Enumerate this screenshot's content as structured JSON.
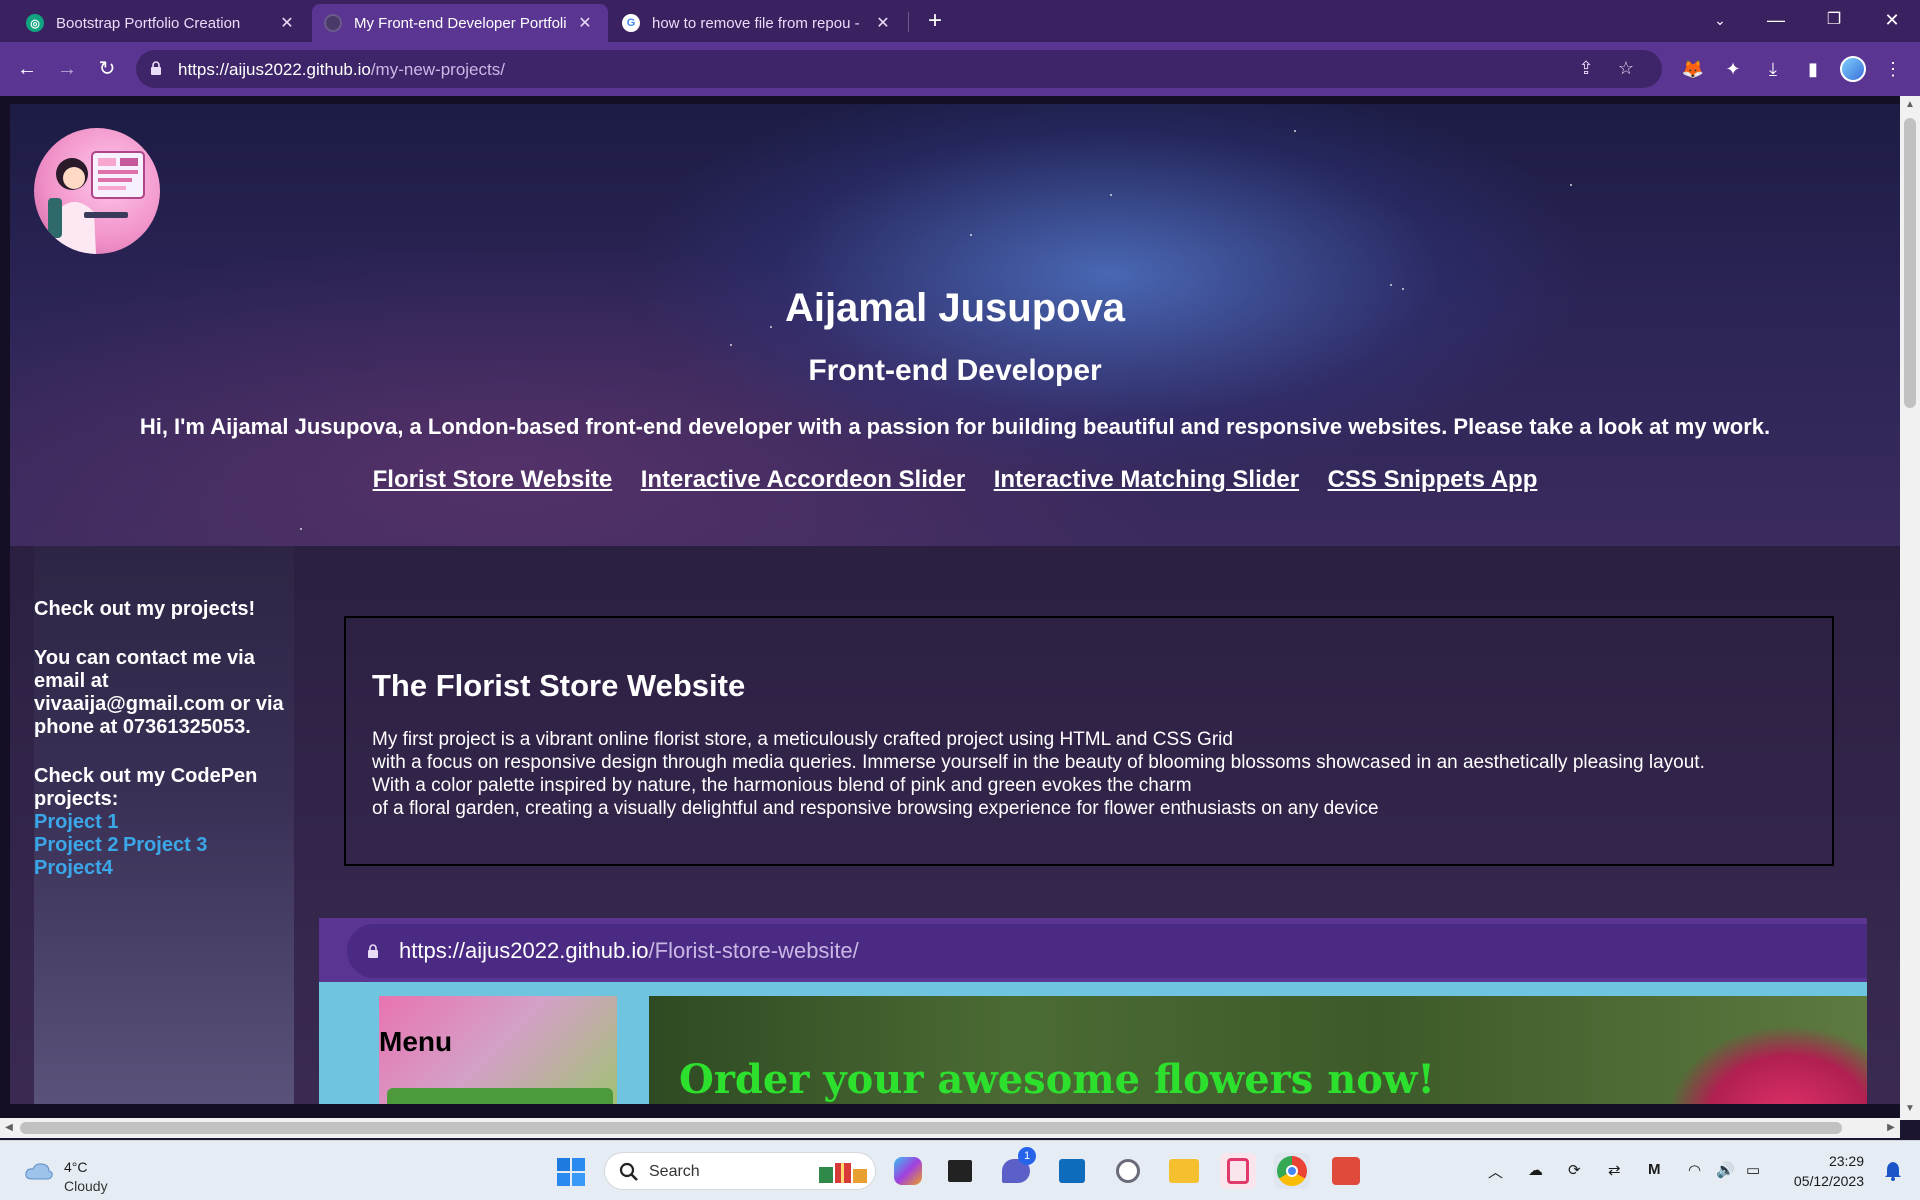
{
  "browser": {
    "tabs": [
      {
        "title": "Bootstrap Portfolio Creation",
        "active": false
      },
      {
        "title": "My Front-end Developer Portfoli",
        "active": true
      },
      {
        "title": "how to remove file from repou -",
        "active": false
      }
    ],
    "url_host": "https://aijus2022.github.io",
    "url_path": "/my-new-projects/"
  },
  "hero": {
    "name": "Aijamal Jusupova",
    "role": "Front-end Developer",
    "intro": "Hi, I'm Aijamal Jusupova, a London-based front-end developer with a passion for building beautiful and responsive websites. Please take a look at my work.",
    "links": [
      "Florist Store Website",
      "Interactive Accordeon Slider",
      "Interactive Matching Slider",
      "CSS Snippets App"
    ]
  },
  "sidebar": {
    "projects_heading": "Check out my projects!",
    "contact": "You can contact me via email at vivaaija@gmail.com or via phone at 07361325053.",
    "codepen_heading": "Check out my CodePen projects:",
    "codepen_links": [
      "Project 1",
      "Project 2",
      "Project 3",
      "Project4"
    ]
  },
  "project": {
    "title": "The Florist Store Website",
    "description_lines": [
      "My first project is a vibrant online florist store, a meticulously crafted project using HTML and CSS Grid",
      "with a focus on responsive design through media queries. Immerse yourself in the beauty of blooming blossoms showcased in an aesthetically pleasing layout.",
      "With a color palette inspired by nature, the harmonious blend of pink and green evokes the charm",
      "of a floral garden, creating a visually delightful and responsive browsing experience for flower enthusiasts on any device"
    ],
    "preview": {
      "url_host": "https://aijus2022.github.io",
      "url_path": "/Florist-store-website/",
      "menu_label": "Menu",
      "headline": "Order your awesome flowers now!"
    }
  },
  "taskbar": {
    "weather_temp": "4°C",
    "weather_condition": "Cloudy",
    "search_placeholder": "Search",
    "chat_badge": "1",
    "time": "23:29",
    "date": "05/12/2023"
  },
  "colors": {
    "tab_strip": "#3a2160",
    "toolbar": "#5a3592",
    "link_blue": "#3aa7e8",
    "headline_green": "#2de02d"
  }
}
